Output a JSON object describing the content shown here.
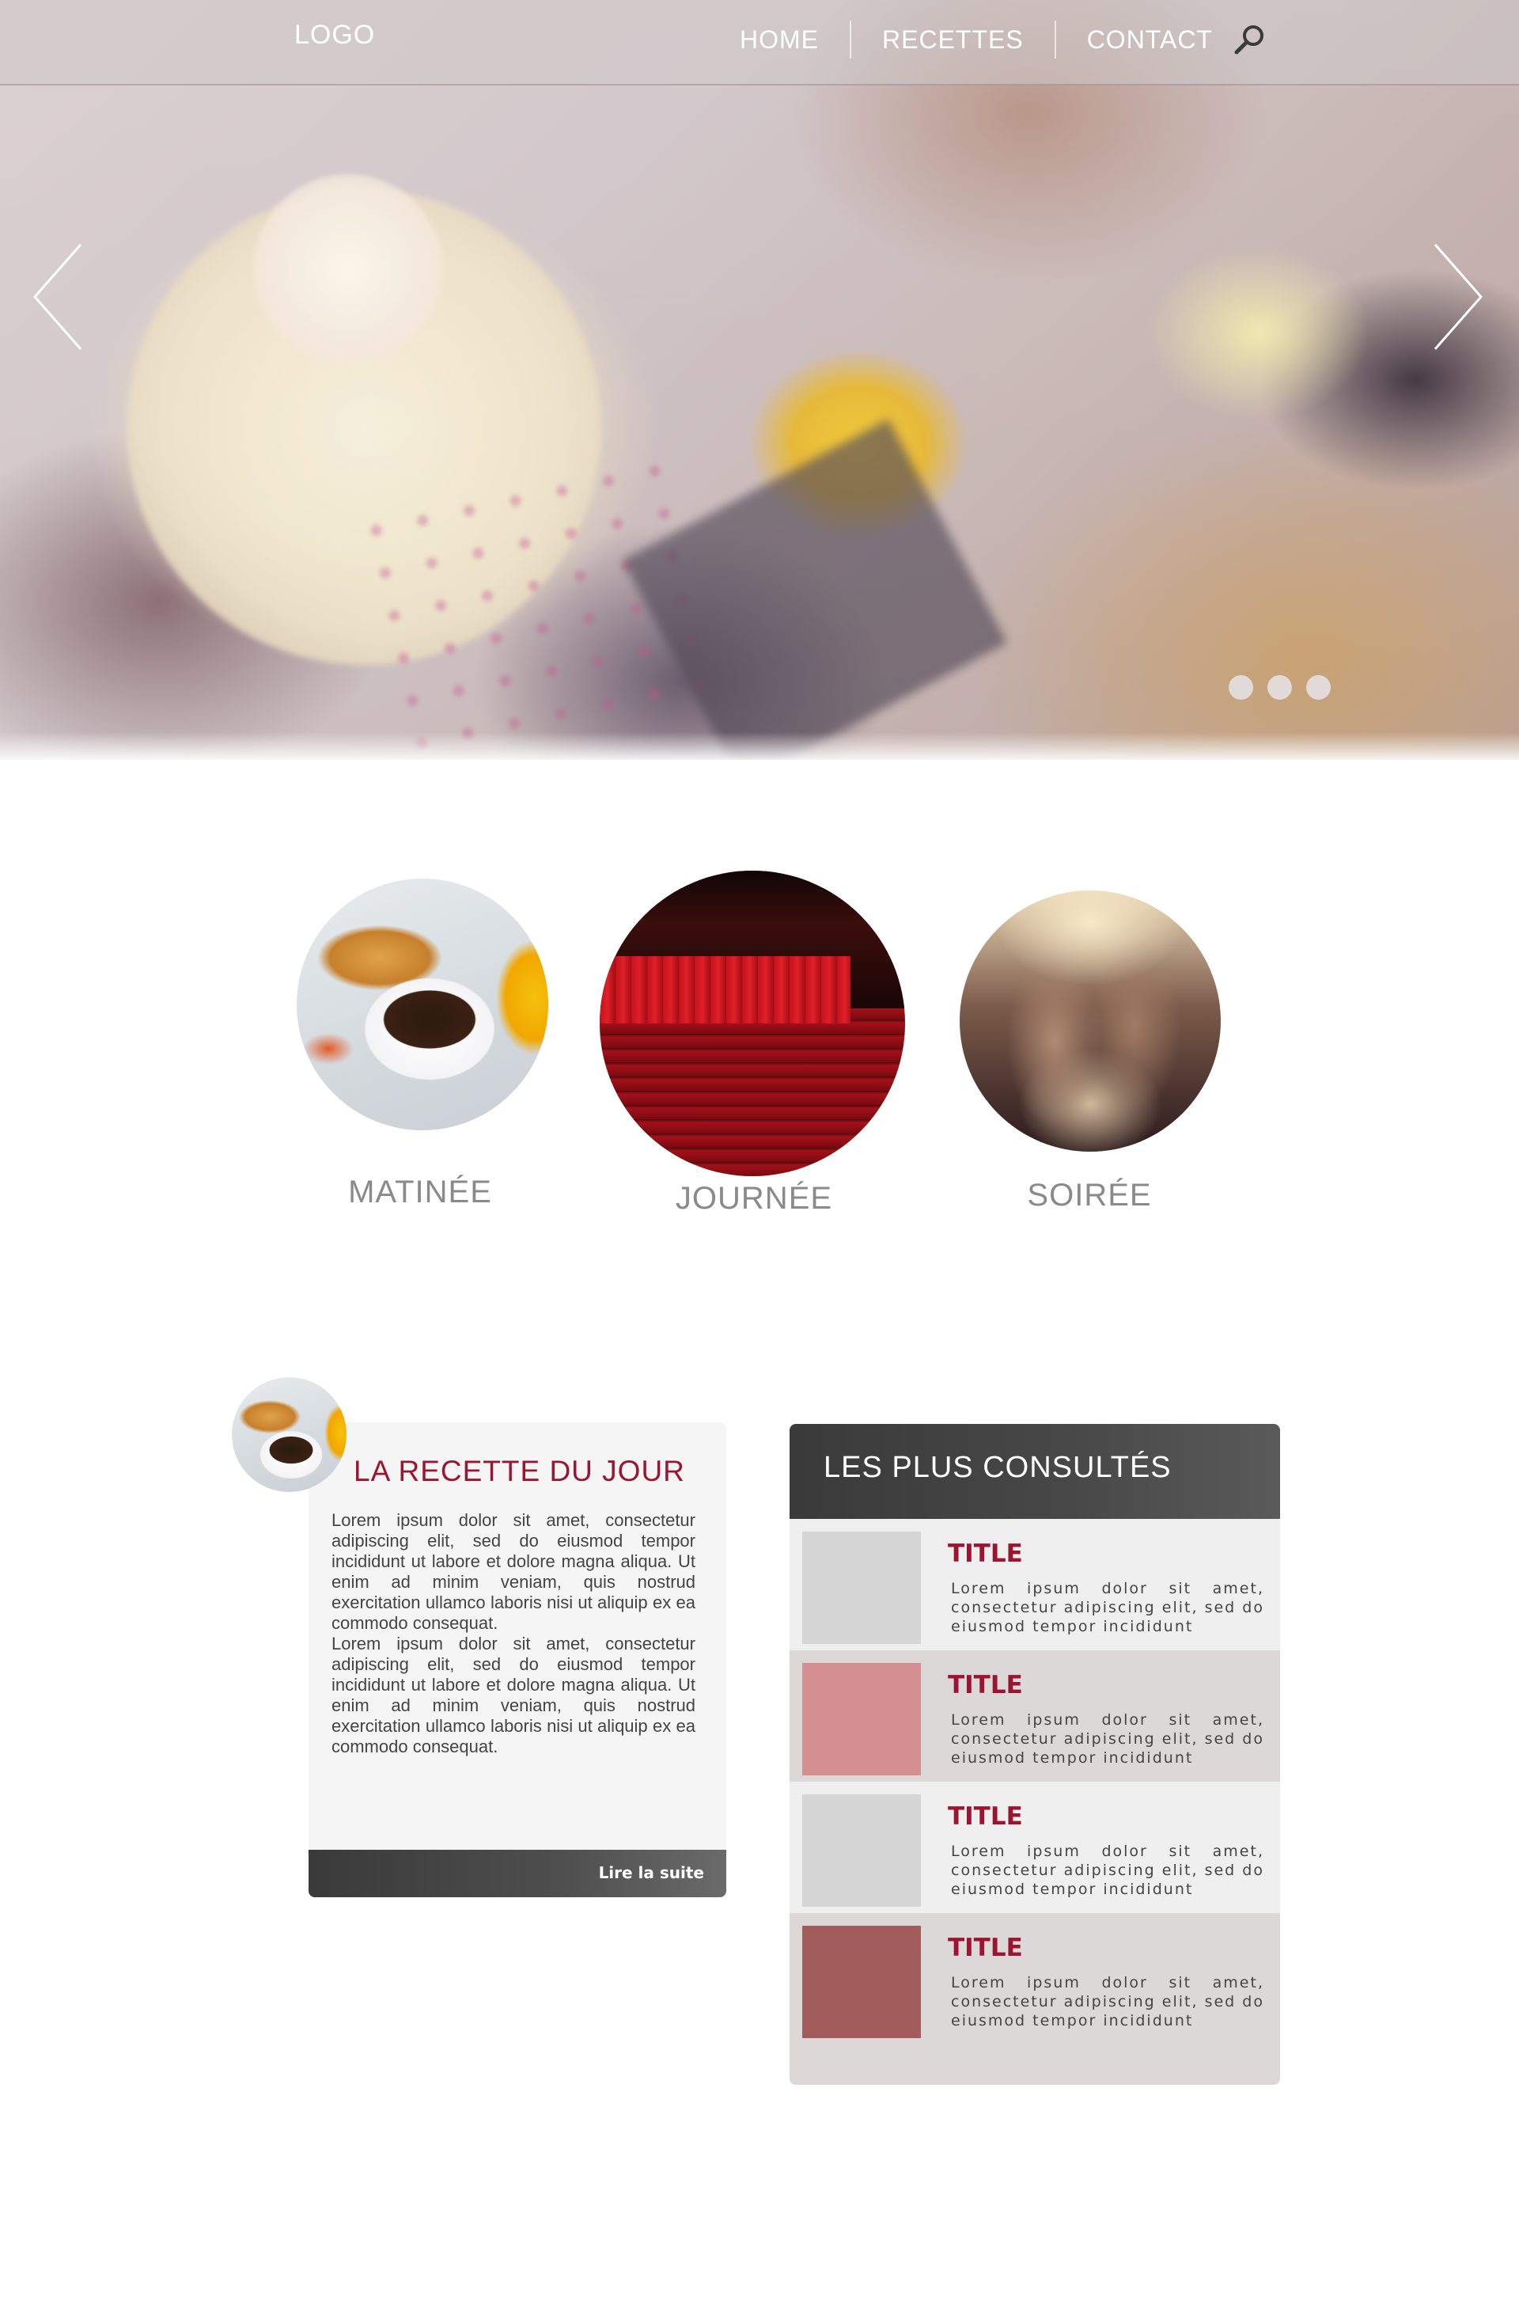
{
  "header": {
    "logo": "LOGO",
    "nav": [
      {
        "label": "HOME"
      },
      {
        "label": "RECETTES"
      },
      {
        "label": "CONTACT"
      }
    ],
    "search_icon": "search-icon"
  },
  "hero": {
    "slide_count": 3,
    "active_slide": 1,
    "left_icon": "chevron-left-icon",
    "right_icon": "chevron-right-icon"
  },
  "categories": [
    {
      "label": "MATINÉE"
    },
    {
      "label": "JOURNÉE"
    },
    {
      "label": "SOIRÉE"
    }
  ],
  "recipe": {
    "title": "LA RECETTE DU JOUR",
    "paragraphs": [
      "Lorem ipsum dolor sit amet, consectetur adipiscing elit, sed do eiusmod tempor incididunt ut labore et dolore magna aliqua. Ut enim ad minim veniam, quis nostrud exercitation ullamco laboris nisi ut aliquip ex ea commodo consequat.",
      "Lorem ipsum dolor sit amet, consectetur adipiscing elit, sed do eiusmod tempor incididunt ut labore et dolore magna aliqua. Ut enim ad minim veniam, quis nostrud exercitation ullamco laboris nisi ut aliquip ex ea commodo consequat."
    ],
    "read_more": "Lire la suite"
  },
  "popular": {
    "title": "LES PLUS CONSULTÉS",
    "items": [
      {
        "title": "TITLE",
        "text": "Lorem ipsum dolor sit amet, consectetur adipiscing elit, sed do eiusmod tempor incididunt",
        "thumb_color": "#d6d6d6",
        "row_color": "#efefef"
      },
      {
        "title": "TITLE",
        "text": "Lorem ipsum dolor sit amet, consectetur adipiscing elit, sed do eiusmod tempor incididunt",
        "thumb_color": "#d49090",
        "row_color": "#dcd8d8"
      },
      {
        "title": "TITLE",
        "text": "Lorem ipsum dolor sit amet, consectetur adipiscing elit, sed do eiusmod tempor incididunt",
        "thumb_color": "#d6d6d6",
        "row_color": "#efefef"
      },
      {
        "title": "TITLE",
        "text": "Lorem ipsum dolor sit amet, consectetur adipiscing elit, sed do eiusmod tempor incididunt",
        "thumb_color": "#a35c5c",
        "row_color": "#dcd8d8"
      }
    ]
  },
  "colors": {
    "accent": "#9b1530",
    "dark_bar": "#3a3a3a",
    "muted_text": "#8a8a8a"
  }
}
